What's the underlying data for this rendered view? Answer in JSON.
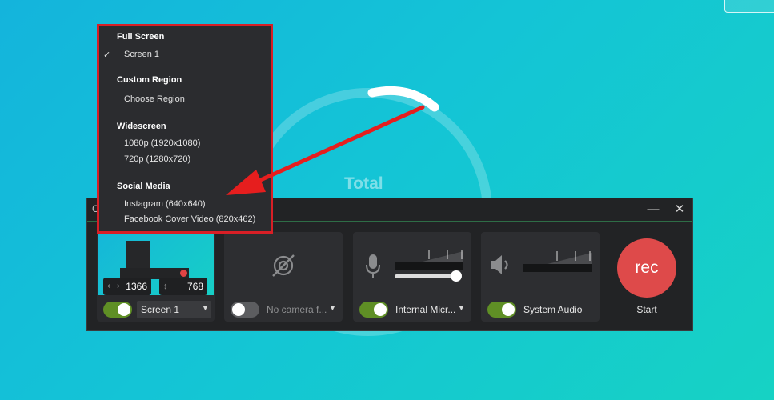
{
  "background": {
    "total_label": "Total"
  },
  "window": {
    "title_initial": "C",
    "minimize_glyph": "—",
    "close_glyph": "✕"
  },
  "screen": {
    "width": "1366",
    "height": "768",
    "selection": "Screen 1",
    "enabled": true
  },
  "camera": {
    "selection": "No camera f...",
    "enabled": false
  },
  "microphone": {
    "selection": "Internal Micr...",
    "enabled": true
  },
  "system_audio": {
    "label": "System Audio",
    "enabled": true
  },
  "record": {
    "button_label": "rec",
    "caption": "Start"
  },
  "menu": {
    "sections": [
      {
        "heading": "Full Screen",
        "items": [
          {
            "label": "Screen 1",
            "checked": true
          }
        ]
      },
      {
        "heading": "Custom Region",
        "items": [
          {
            "label": "Choose Region",
            "checked": false
          }
        ]
      },
      {
        "heading": "Widescreen",
        "items": [
          {
            "label": "1080p (1920x1080)",
            "checked": false
          },
          {
            "label": "720p (1280x720)",
            "checked": false
          }
        ]
      },
      {
        "heading": "Social Media",
        "items": [
          {
            "label": "Instagram (640x640)",
            "checked": false
          },
          {
            "label": "Facebook Cover Video (820x462)",
            "checked": false
          }
        ]
      }
    ],
    "check_glyph": "✓"
  },
  "colors": {
    "accent_green": "#5f8f25",
    "record_red": "#de4a4a",
    "highlight_red": "#d81f26"
  }
}
